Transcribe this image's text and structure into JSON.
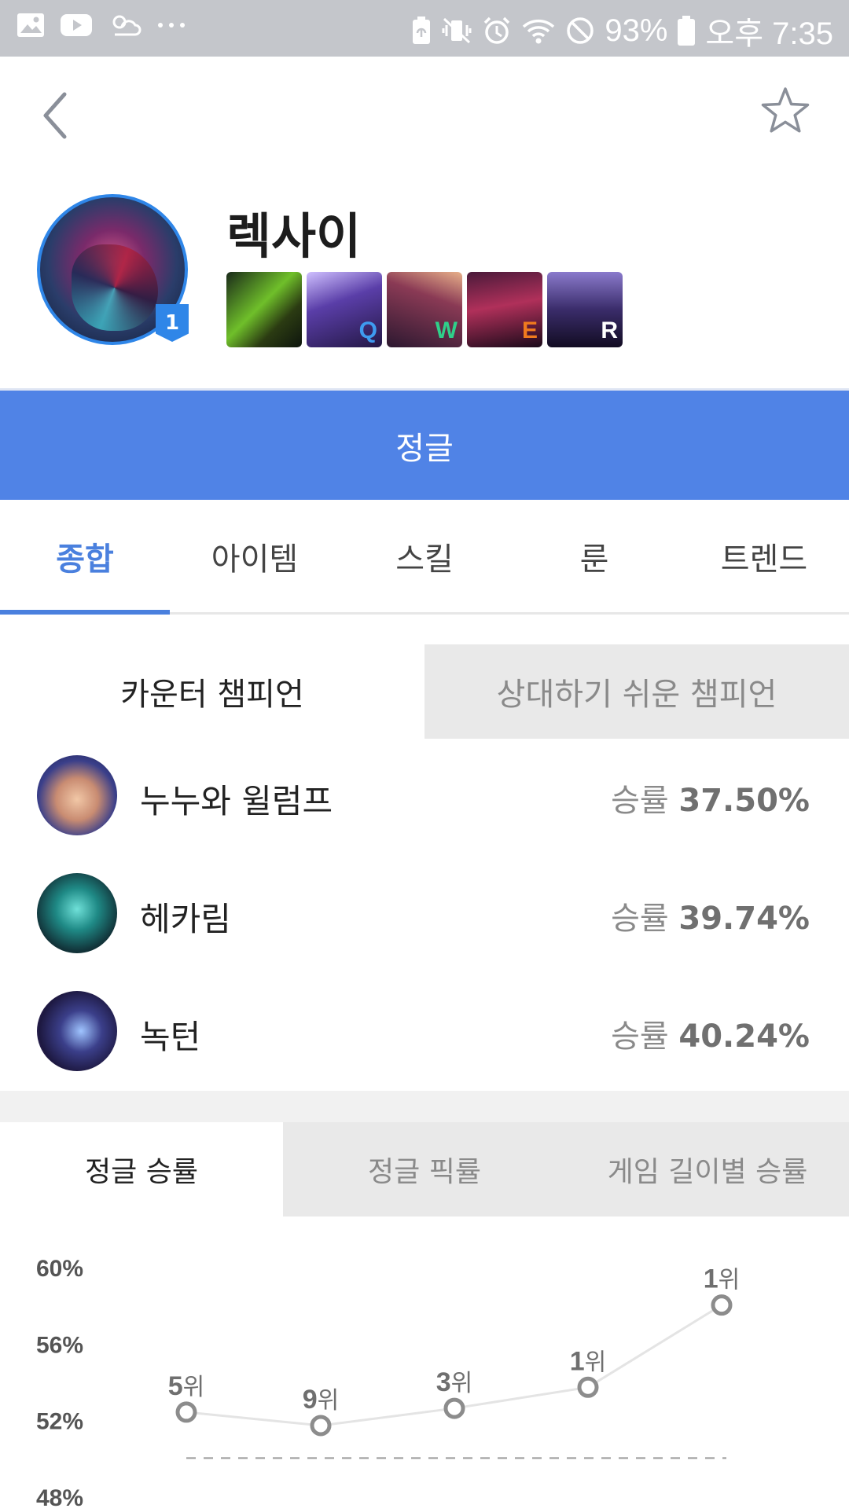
{
  "status_bar": {
    "battery": "93%",
    "time": "오후 7:35",
    "left_icons": [
      "gallery-icon",
      "youtube-icon",
      "weather-icon",
      "more-dots-icon"
    ],
    "right_icons": [
      "battery-saver-icon",
      "vibrate-icon",
      "alarm-icon",
      "wifi-icon",
      "blocked-icon",
      "battery-icon"
    ]
  },
  "header": {
    "back_icon": "chevron-left-icon",
    "favorite_icon": "star-outline-icon"
  },
  "champion": {
    "name": "렉사이",
    "rank_badge": "1",
    "skills": [
      {
        "key": "",
        "key_color": "#ffffff"
      },
      {
        "key": "Q",
        "key_color": "#3e9bf0"
      },
      {
        "key": "W",
        "key_color": "#2fd08a"
      },
      {
        "key": "E",
        "key_color": "#f07a1e"
      },
      {
        "key": "R",
        "key_color": "#ffffff"
      }
    ]
  },
  "role": "정글",
  "tabs": [
    {
      "label": "종합",
      "active": true
    },
    {
      "label": "아이템",
      "active": false
    },
    {
      "label": "스킬",
      "active": false
    },
    {
      "label": "룬",
      "active": false
    },
    {
      "label": "트렌드",
      "active": false
    }
  ],
  "matchup_tabs": [
    {
      "label": "카운터 챔피언",
      "active": true
    },
    {
      "label": "상대하기 쉬운 챔피언",
      "active": false
    }
  ],
  "counters": [
    {
      "name": "누누와 윌럼프",
      "rate_label": "승률",
      "rate": "37.50%"
    },
    {
      "name": "헤카림",
      "rate_label": "승률",
      "rate": "39.74%"
    },
    {
      "name": "녹턴",
      "rate_label": "승률",
      "rate": "40.24%"
    }
  ],
  "graph_tabs": [
    {
      "label": "정글 승률",
      "active": true
    },
    {
      "label": "정글 픽률",
      "active": false
    },
    {
      "label": "게임 길이별 승률",
      "active": false
    }
  ],
  "chart_data": {
    "type": "line",
    "title": "",
    "xlabel": "",
    "ylabel": "",
    "y_ticks": [
      "60%",
      "56%",
      "52%",
      "48%"
    ],
    "ylim": [
      48,
      60
    ],
    "reference_line": 50,
    "series": [
      {
        "values": [
          52.4,
          51.7,
          52.6,
          53.7,
          58.0
        ],
        "point_labels": [
          {
            "num": "5",
            "suffix": "위"
          },
          {
            "num": "9",
            "suffix": "위"
          },
          {
            "num": "3",
            "suffix": "위"
          },
          {
            "num": "1",
            "suffix": "위"
          },
          {
            "num": "1",
            "suffix": "위"
          }
        ]
      }
    ],
    "colors": {
      "line": "#e4e4e4",
      "marker": "#8c8c8c",
      "reference": "#9a9a9a",
      "tick_text": "#555555"
    }
  },
  "colors": {
    "accent": "#4a80de",
    "role_bar": "#5083e6",
    "portrait_ring": "#2f86e8"
  }
}
